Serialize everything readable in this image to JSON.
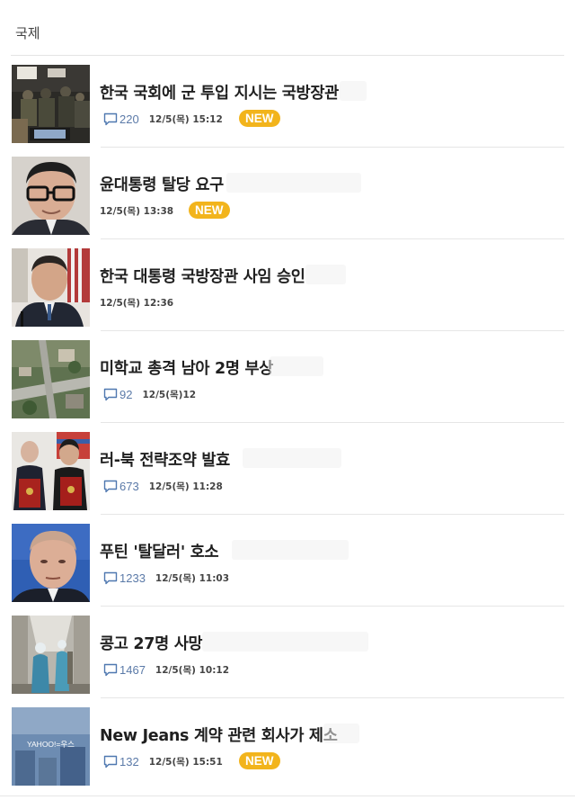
{
  "section": {
    "title": "국제"
  },
  "colors": {
    "badge": "#f2b41c",
    "comment": "#5b7aa8"
  },
  "items": [
    {
      "title": "한국 국회에 군 투입 지시는 국방장관",
      "comments": "220",
      "date": "12/5(목) 15:12",
      "badge": "NEW",
      "image": "soldiers-at-night-photo"
    },
    {
      "title": "윤대통령 탈당 요구",
      "comments": "",
      "date": "12/5(목) 13:38",
      "badge": "NEW",
      "image": "man-with-glasses-portrait"
    },
    {
      "title": "한국 대통령 국방장관 사임 승인",
      "comments": "",
      "date": "12/5(목) 12:36",
      "badge": "",
      "image": "minister-at-podium-photo"
    },
    {
      "title": "미학교 총격 남아 2명 부상",
      "comments": "92",
      "date": "12/5(목)12",
      "badge": "",
      "image": "aerial-town-photo"
    },
    {
      "title": "러-북 전략조약 발효",
      "comments": "673",
      "date": "12/5(목) 11:28",
      "badge": "",
      "image": "two-leaders-with-folders-photo"
    },
    {
      "title": "푸틴 '탈달러' 호소",
      "comments": "1233",
      "date": "12/5(목) 11:03",
      "badge": "",
      "image": "putin-portrait"
    },
    {
      "title": "콩고 27명 사망",
      "comments": "1467",
      "date": "12/5(목) 10:12",
      "badge": "",
      "image": "medical-workers-hallway-photo"
    },
    {
      "title": "New Jeans 계약 관련 회사가 제소",
      "comments": "132",
      "date": "12/5(목) 15:51",
      "badge": "NEW",
      "image": "yahoo-building-photo",
      "image_text": "YAHOO!=우스"
    }
  ]
}
